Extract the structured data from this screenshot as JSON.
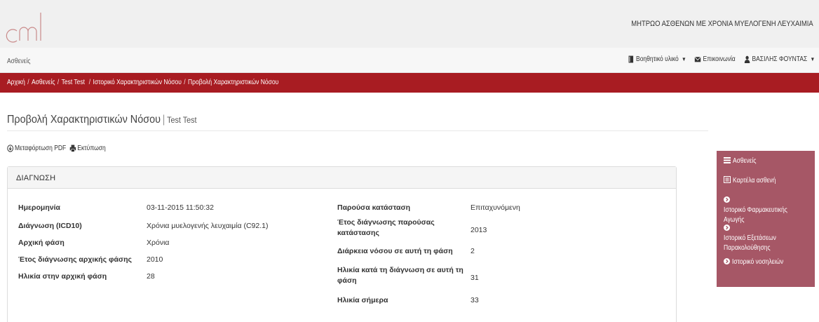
{
  "header": {
    "registry_title": "ΜΗΤΡΩΟ ΑΣΘΕΝΩΝ ΜΕ ΧΡΟΝΙΑ ΜΥΕΛΟΓΕΝΗ ΛΕΥΧΑΙΜΙΑ"
  },
  "nav": {
    "left_label": "Ασθενείς",
    "help_label": "Βοηθητικό υλικό",
    "contact_label": "Επικοινωνία",
    "user_label": "ΒΑΣΙΛΗΣ ΦΟΥΝΤΑΣ"
  },
  "breadcrumb": {
    "items": [
      "Αρχική",
      "Ασθενείς",
      "Test Test",
      "Ιστορικό Χαρακτηριστικών Νόσου",
      "Προβολή Χαρακτηριστικών Νόσου"
    ]
  },
  "page": {
    "title": "Προβολή Χαρακτηριστικών Νόσου",
    "subtitle": "Test Test"
  },
  "actions": {
    "pdf_label": "Μεταφόρτωση PDF",
    "print_label": "Εκτύπωση"
  },
  "panel": {
    "heading": "ΔΙΑΓΝΩΣΗ",
    "left": [
      {
        "label": "Ημερομηνία",
        "value": "03-11-2015 11:50:32"
      },
      {
        "label": "Διάγνωση (ICD10)",
        "value": "Χρόνια μυελογενής λευχαιμία (C92.1)"
      },
      {
        "label": "Αρχική φάση",
        "value": "Χρόνια"
      },
      {
        "label": "Έτος διάγνωσης αρχικής φάσης",
        "value": "2010"
      },
      {
        "label": "Ηλικία στην αρχική φάση",
        "value": "28"
      }
    ],
    "right": [
      {
        "label": "Παρούσα κατάσταση",
        "value": "Επιταχυνόμενη"
      },
      {
        "label": "Έτος διάγνωσης παρούσας κατάστασης",
        "value": "2013"
      },
      {
        "label": "Διάρκεια νόσου σε αυτή τη φάση",
        "value": "2"
      },
      {
        "label": "Ηλικία κατά τη διάγνωση σε αυτή τη φάση",
        "value": "31"
      },
      {
        "label": "Ηλικία σήμερα",
        "value": "33"
      }
    ]
  },
  "sidebar": {
    "items": [
      {
        "label": "Ασθενείς",
        "icon": "list-icon"
      },
      {
        "label": "Καρτέλα ασθενή",
        "icon": "card-icon"
      },
      {
        "label": "Ιστορικό Φαρμακευτικής Αγωγής",
        "icon": "arrow-circle-icon"
      },
      {
        "label": "Ιστορικό Εξετάσεων Παρακολούθησης",
        "icon": "arrow-circle-icon"
      },
      {
        "label": "Ιστορικό νοσηλειών",
        "icon": "arrow-circle-icon"
      }
    ]
  },
  "colors": {
    "brand_red": "#a81c22",
    "sidebar": "#a65766",
    "logo": "#c98a8a"
  }
}
